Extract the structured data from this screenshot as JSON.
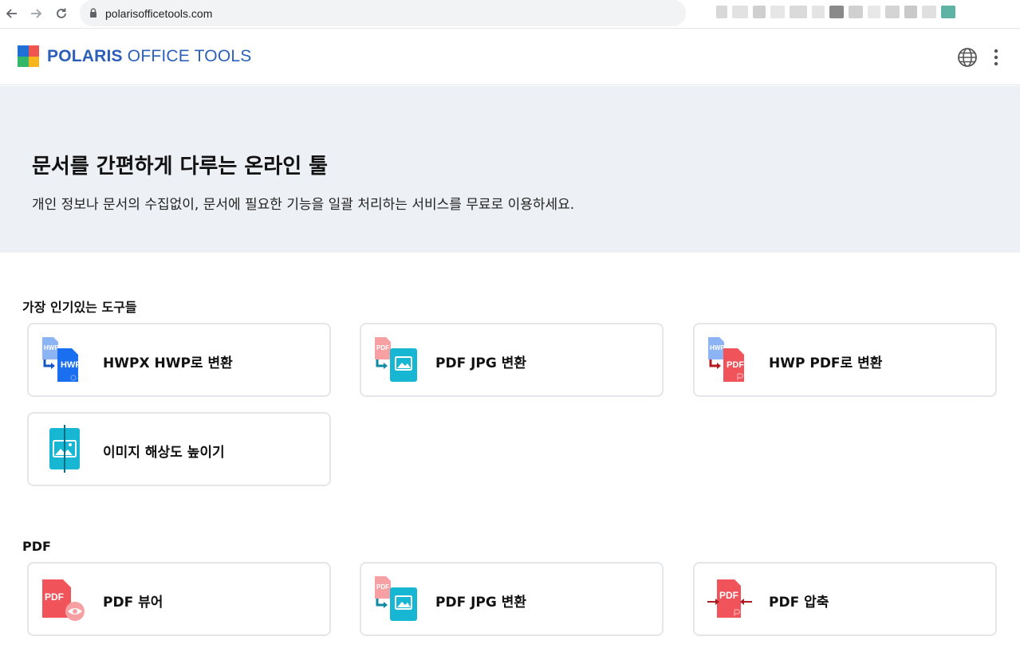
{
  "browser": {
    "url": "polarisofficetools.com"
  },
  "header": {
    "logo_bold": "POLARIS",
    "logo_light": "OFFICE TOOLS"
  },
  "hero": {
    "title": "문서를 간편하게 다루는 온라인 툴",
    "subtitle": "개인 정보나 문서의 수집없이, 문서에 필요한 기능을 일괄 처리하는 서비스를 무료로 이용하세요."
  },
  "popular": {
    "title": "가장 인기있는 도구들",
    "cards": [
      {
        "label": "HWPX HWP로 변환",
        "icon": "hwpx-to-hwp-icon"
      },
      {
        "label": "PDF JPG 변환",
        "icon": "pdf-to-jpg-icon"
      },
      {
        "label": "HWP PDF로 변환",
        "icon": "hwp-to-pdf-icon"
      },
      {
        "label": "이미지 해상도 높이기",
        "icon": "image-upscale-icon"
      }
    ]
  },
  "pdf": {
    "title": "PDF",
    "cards": [
      {
        "label": "PDF 뷰어",
        "icon": "pdf-viewer-icon"
      },
      {
        "label": "PDF JPG 변환",
        "icon": "pdf-to-jpg-icon"
      },
      {
        "label": "PDF 압축",
        "icon": "pdf-compress-icon"
      }
    ]
  },
  "icon_text": {
    "hwpx": "HWPX",
    "hwp": "HWP",
    "pdf": "PDF"
  },
  "colors": {
    "brand_blue": "#2c5fb8",
    "hwp_blue": "#1a6ef0",
    "pdf_red": "#f0545a",
    "jpg_cyan": "#17b7d4"
  }
}
